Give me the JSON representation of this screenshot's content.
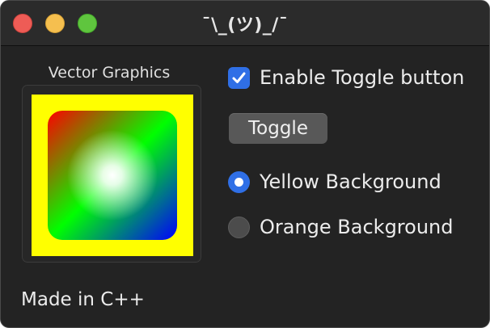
{
  "window": {
    "title": "¯\\_(ツ)_/¯",
    "controls": {
      "close_color": "#ee5c56",
      "minimize_color": "#f5bf4f",
      "maximize_color": "#5fc53e"
    }
  },
  "graphics": {
    "group_label": "Vector Graphics",
    "background_color": "#ffff00",
    "gradient_corners": [
      "#ff0000",
      "#00ff00",
      "#0000ff"
    ],
    "center_glow": "#ffffff"
  },
  "controls": {
    "checkbox": {
      "label": "Enable Toggle button",
      "checked": true
    },
    "toggle_button_label": "Toggle",
    "radios": [
      {
        "label": "Yellow Background",
        "selected": true
      },
      {
        "label": "Orange Background",
        "selected": false
      }
    ]
  },
  "footer": "Made in C++",
  "colors": {
    "accent": "#2f6fe6",
    "window_bg": "#232323"
  }
}
